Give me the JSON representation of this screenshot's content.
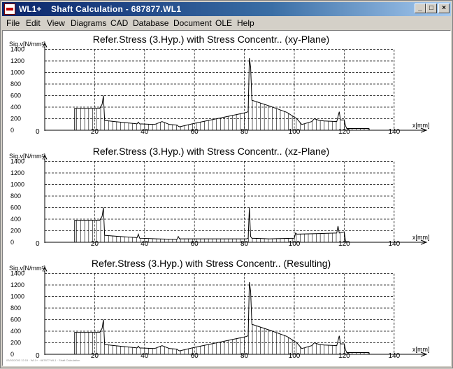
{
  "window": {
    "app_name": "WL1+",
    "title": "Shaft Calculation  -  687877.WL1",
    "buttons": [
      "minimize",
      "maximize",
      "close"
    ]
  },
  "menu": [
    "File",
    "Edit",
    "View",
    "Diagrams",
    "CAD",
    "Database",
    "Document",
    "OLE",
    "Help"
  ],
  "status_text": "03/03/2003 12:15 · WL1+ · 687877.WL1 · Shaft Calculation",
  "chart_data": [
    {
      "type": "line",
      "title": "Refer.Stress (3.Hyp.) with Stress Concentr.. (xy-Plane)",
      "ylabel": "Sig.v[N/mm²]",
      "xlabel": "x[mm]",
      "xlim": [
        0,
        140
      ],
      "ylim": [
        0,
        1400
      ],
      "x_ticks": [
        20,
        40,
        60,
        80,
        100,
        120,
        140
      ],
      "y_ticks": [
        0,
        200,
        400,
        600,
        800,
        1000,
        1200,
        1400
      ],
      "grid": true,
      "x": [
        12,
        12,
        22,
        23,
        23.5,
        24,
        28,
        35,
        37,
        37.5,
        38,
        44,
        47,
        50,
        53,
        53.5,
        54,
        60,
        70,
        80,
        81.5,
        82,
        82.5,
        83,
        90,
        97,
        101,
        103,
        107,
        108,
        110,
        112,
        117,
        118,
        118.5,
        120,
        120.5,
        121,
        130
      ],
      "y": [
        0,
        380,
        380,
        450,
        600,
        170,
        150,
        120,
        110,
        140,
        110,
        100,
        150,
        100,
        90,
        70,
        60,
        120,
        210,
        300,
        320,
        1250,
        1100,
        520,
        420,
        310,
        200,
        100,
        150,
        200,
        170,
        160,
        150,
        320,
        180,
        180,
        80,
        30,
        30
      ]
    },
    {
      "type": "line",
      "title": "Refer.Stress (3.Hyp.) with Stress Concentr.. (xz-Plane)",
      "ylabel": "Sig.v[N/mm²]",
      "xlabel": "x[mm]",
      "xlim": [
        0,
        140
      ],
      "ylim": [
        0,
        1400
      ],
      "x_ticks": [
        20,
        40,
        60,
        80,
        100,
        120,
        140
      ],
      "y_ticks": [
        0,
        200,
        400,
        600,
        800,
        1000,
        1200,
        1400
      ],
      "grid": true,
      "x": [
        12,
        12,
        22,
        23,
        23.5,
        24,
        30,
        37,
        37.5,
        38,
        45,
        53,
        53.5,
        54,
        81,
        81.5,
        82,
        82.5,
        83,
        90,
        100,
        100.5,
        101,
        110,
        117,
        117.5,
        118,
        120,
        120.5,
        121
      ],
      "y": [
        0,
        380,
        380,
        450,
        600,
        120,
        100,
        80,
        140,
        70,
        60,
        50,
        100,
        60,
        60,
        70,
        600,
        100,
        70,
        60,
        70,
        160,
        140,
        150,
        160,
        280,
        160,
        180,
        30,
        0
      ]
    },
    {
      "type": "line",
      "title": "Refer.Stress (3.Hyp.) with Stress Concentr.. (Resulting)",
      "ylabel": "Sig.v[N/mm²]",
      "xlabel": "x[mm]",
      "xlim": [
        0,
        140
      ],
      "ylim": [
        0,
        1400
      ],
      "x_ticks": [
        20,
        40,
        60,
        80,
        100,
        120,
        140
      ],
      "y_ticks": [
        0,
        200,
        400,
        600,
        800,
        1000,
        1200,
        1400
      ],
      "grid": true,
      "x": [
        12,
        12,
        22,
        23,
        23.5,
        24,
        28,
        35,
        37,
        37.5,
        38,
        44,
        47,
        50,
        53,
        53.5,
        54,
        60,
        70,
        80,
        81.5,
        82,
        82.5,
        83,
        90,
        97,
        101,
        103,
        107,
        108,
        110,
        112,
        117,
        118,
        118.5,
        120,
        120.5,
        121,
        130
      ],
      "y": [
        0,
        380,
        380,
        450,
        600,
        170,
        150,
        120,
        110,
        140,
        110,
        100,
        150,
        100,
        90,
        70,
        60,
        120,
        210,
        300,
        320,
        1250,
        1100,
        520,
        420,
        310,
        200,
        100,
        150,
        200,
        170,
        160,
        150,
        320,
        180,
        180,
        80,
        30,
        30
      ]
    }
  ]
}
